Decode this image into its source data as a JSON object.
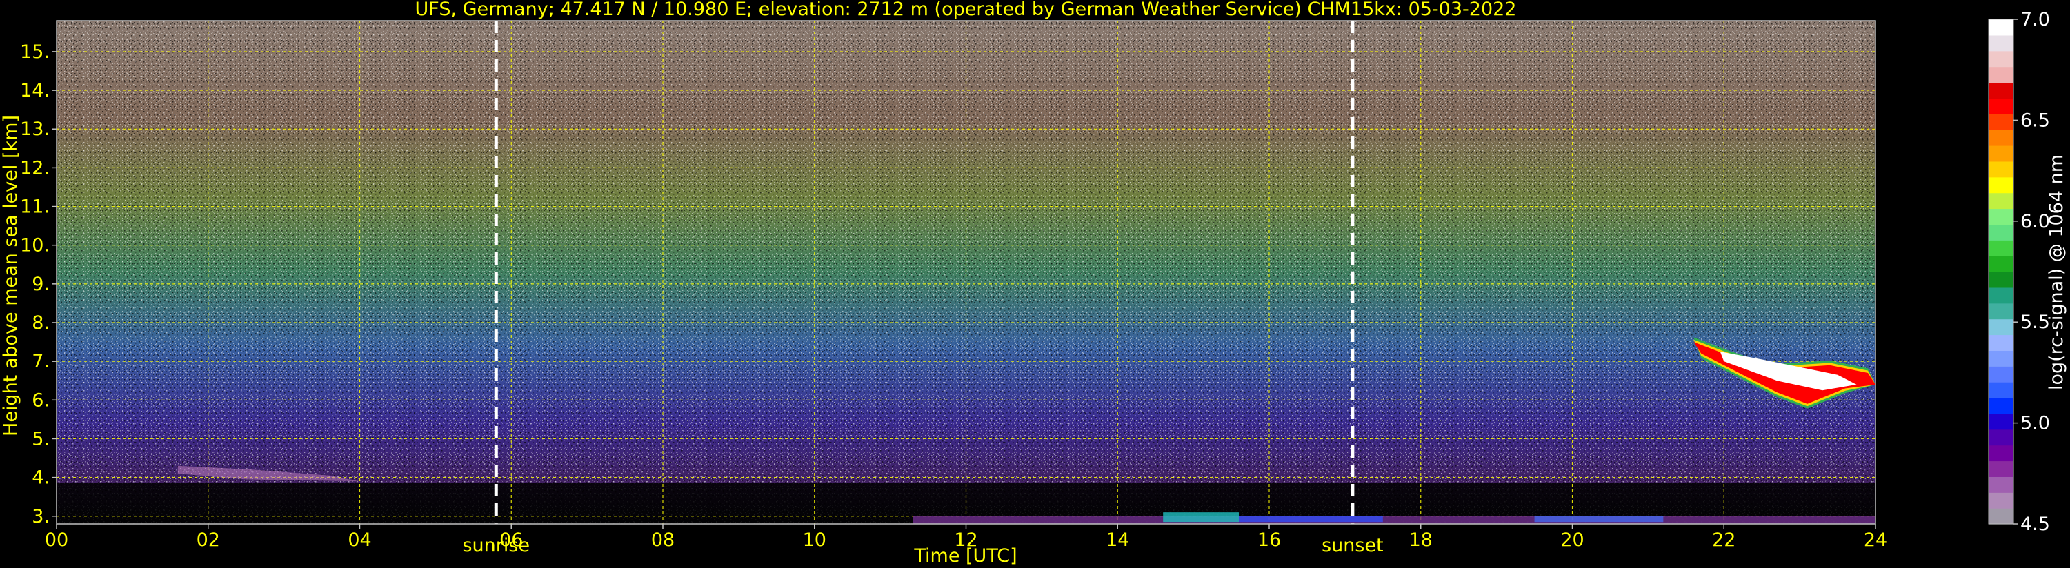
{
  "chart_data": {
    "type": "heatmap",
    "title": "UFS, Germany; 47.417 N / 10.980 E; elevation: 2712 m  (operated by German Weather Service)    CHM15kx: 05-03-2022",
    "xlabel": "Time [UTC]",
    "ylabel": "Height above mean sea level [km]",
    "xlim": [
      0,
      24
    ],
    "ylim": [
      2.8,
      15.8
    ],
    "x_ticks": [
      "00",
      "02",
      "04",
      "06",
      "08",
      "10",
      "12",
      "14",
      "16",
      "18",
      "20",
      "22",
      "24"
    ],
    "x_tick_values": [
      0,
      2,
      4,
      6,
      8,
      10,
      12,
      14,
      16,
      18,
      20,
      22,
      24
    ],
    "y_ticks": [
      "3.",
      "4.",
      "5.",
      "6.",
      "7.",
      "8.",
      "9.",
      "10.",
      "11.",
      "12.",
      "13.",
      "14.",
      "15."
    ],
    "y_tick_values": [
      3,
      4,
      5,
      6,
      7,
      8,
      9,
      10,
      11,
      12,
      13,
      14,
      15
    ],
    "grid": true,
    "events": [
      {
        "label": "sunrise",
        "x": 5.8
      },
      {
        "label": "sunset",
        "x": 17.1
      }
    ],
    "cloud_layer": {
      "x_start": 21.6,
      "x_end": 24.0,
      "y_bottom": 5.9,
      "y_top": 7.6
    },
    "colorbar": {
      "label": "log(rc-signal) @ 1064 nm",
      "range": [
        4.5,
        7.0
      ],
      "ticks": [
        "7.0",
        "6.5",
        "6.0",
        "5.5",
        "5.0",
        "4.5"
      ],
      "tick_values": [
        7.0,
        6.5,
        6.0,
        5.5,
        5.0,
        4.5
      ],
      "colors": [
        "#a09aa8",
        "#b08ab8",
        "#a060b0",
        "#8a2aa0",
        "#7000a0",
        "#5000b0",
        "#2000d0",
        "#0030ff",
        "#3060ff",
        "#5b7cff",
        "#7c9cff",
        "#9cb4ff",
        "#80c8e0",
        "#40b0a0",
        "#20a080",
        "#109020",
        "#20b020",
        "#40d040",
        "#60e080",
        "#80f080",
        "#c0f040",
        "#ffff00",
        "#ffd000",
        "#ffa000",
        "#ff8000",
        "#ff4000",
        "#ff0000",
        "#e00000",
        "#f0b0b0",
        "#f0c8c8",
        "#e8e0e8",
        "#ffffff"
      ]
    }
  }
}
